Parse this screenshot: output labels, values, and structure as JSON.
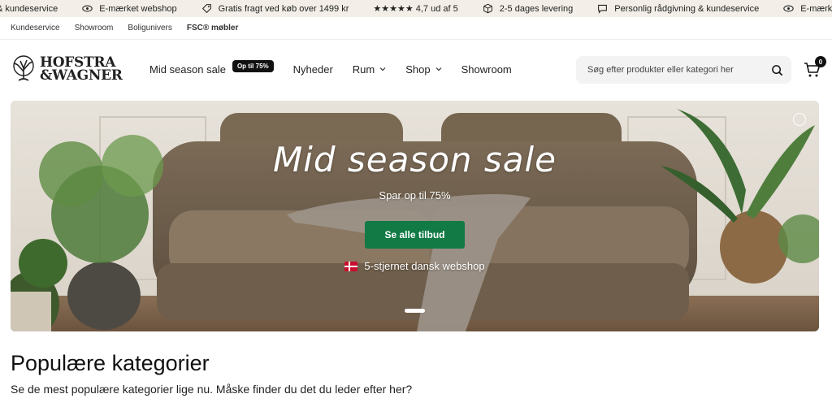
{
  "announcement": {
    "items": [
      {
        "icon": "chat-icon",
        "text": "& kundeservice"
      },
      {
        "icon": "eye-icon",
        "text": "E-mærket webshop"
      },
      {
        "icon": "tag-icon",
        "text": "Gratis fragt ved køb over 1499 kr"
      },
      {
        "icon": "stars-icon",
        "text": "★★★★★ 4,7 ud af 5"
      },
      {
        "icon": "box-icon",
        "text": "2-5 dages levering"
      },
      {
        "icon": "chat-icon",
        "text": "Personlig rådgivning & kundeservice"
      },
      {
        "icon": "eye-icon",
        "text": "E-mærket w"
      }
    ]
  },
  "utility_links": [
    "Kundeservice",
    "Showroom",
    "Boligunivers",
    "FSC® møbler"
  ],
  "logo": {
    "line1": "HOFSTRA",
    "line2": "&WAGNER"
  },
  "nav": {
    "sale": "Mid season sale",
    "sale_badge": "Op til 75%",
    "news": "Nyheder",
    "rooms": "Rum",
    "shop": "Shop",
    "showroom": "Showroom"
  },
  "search": {
    "placeholder": "Søg efter produkter eller kategori her"
  },
  "cart": {
    "count": "0"
  },
  "hero": {
    "title": "Mid season sale",
    "subtitle": "Spar op til 75%",
    "button": "Se alle tilbud",
    "trust": "5-stjernet dansk webshop"
  },
  "categories": {
    "title": "Populære kategorier",
    "subtitle": "Se de mest populære kategorier lige nu. Måske finder du det du leder efter her?"
  },
  "colors": {
    "accent_green": "#117a45",
    "announce_bg": "#f3efe8",
    "dark": "#111111"
  }
}
